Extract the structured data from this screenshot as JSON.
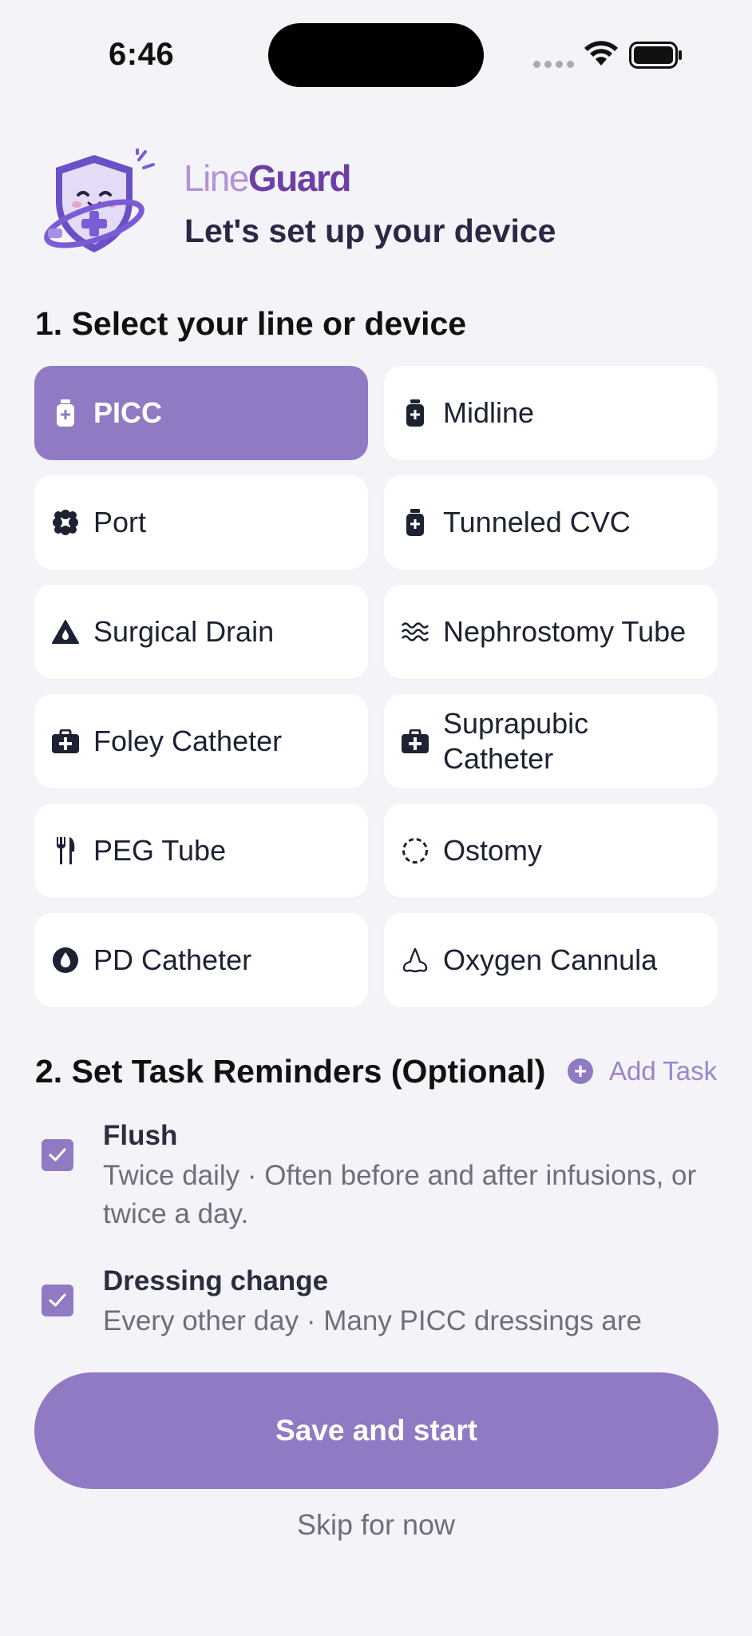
{
  "status_bar": {
    "time": "6:46"
  },
  "header": {
    "brand_light": "Line",
    "brand_bold": "Guard",
    "subtitle": "Let's set up your device"
  },
  "section1": {
    "title": "1. Select your line or device"
  },
  "devices": [
    {
      "label": "PICC",
      "icon": "vial-icon",
      "selected": true
    },
    {
      "label": "Midline",
      "icon": "vial-icon",
      "selected": false
    },
    {
      "label": "Port",
      "icon": "port-icon",
      "selected": false
    },
    {
      "label": "Tunneled CVC",
      "icon": "vial-icon",
      "selected": false
    },
    {
      "label": "Surgical Drain",
      "icon": "drop-triangle-icon",
      "selected": false
    },
    {
      "label": "Nephrostomy Tube",
      "icon": "waves-icon",
      "selected": false
    },
    {
      "label": "Foley Catheter",
      "icon": "medical-kit-icon",
      "selected": false
    },
    {
      "label": "Suprapubic Catheter",
      "icon": "medical-kit-icon",
      "selected": false
    },
    {
      "label": "PEG Tube",
      "icon": "utensils-icon",
      "selected": false
    },
    {
      "label": "Ostomy",
      "icon": "dashed-circle-icon",
      "selected": false
    },
    {
      "label": "PD Catheter",
      "icon": "droplet-icon",
      "selected": false
    },
    {
      "label": "Oxygen Cannula",
      "icon": "nose-icon",
      "selected": false
    }
  ],
  "section2": {
    "title": "2. Set Task Reminders (Optional)",
    "add_task": "Add Task"
  },
  "tasks": [
    {
      "title": "Flush",
      "description": "Twice daily · Often before and after infusions, or twice a day.",
      "checked": true
    },
    {
      "title": "Dressing change",
      "description": "Every other day · Many PICC dressings are",
      "checked": true
    }
  ],
  "actions": {
    "save": "Save and start",
    "skip": "Skip for now"
  },
  "colors": {
    "accent": "#8f7ac3",
    "background": "#f4f4f8",
    "brand_dark": "#6d3fa6",
    "brand_light": "#b392d6"
  }
}
